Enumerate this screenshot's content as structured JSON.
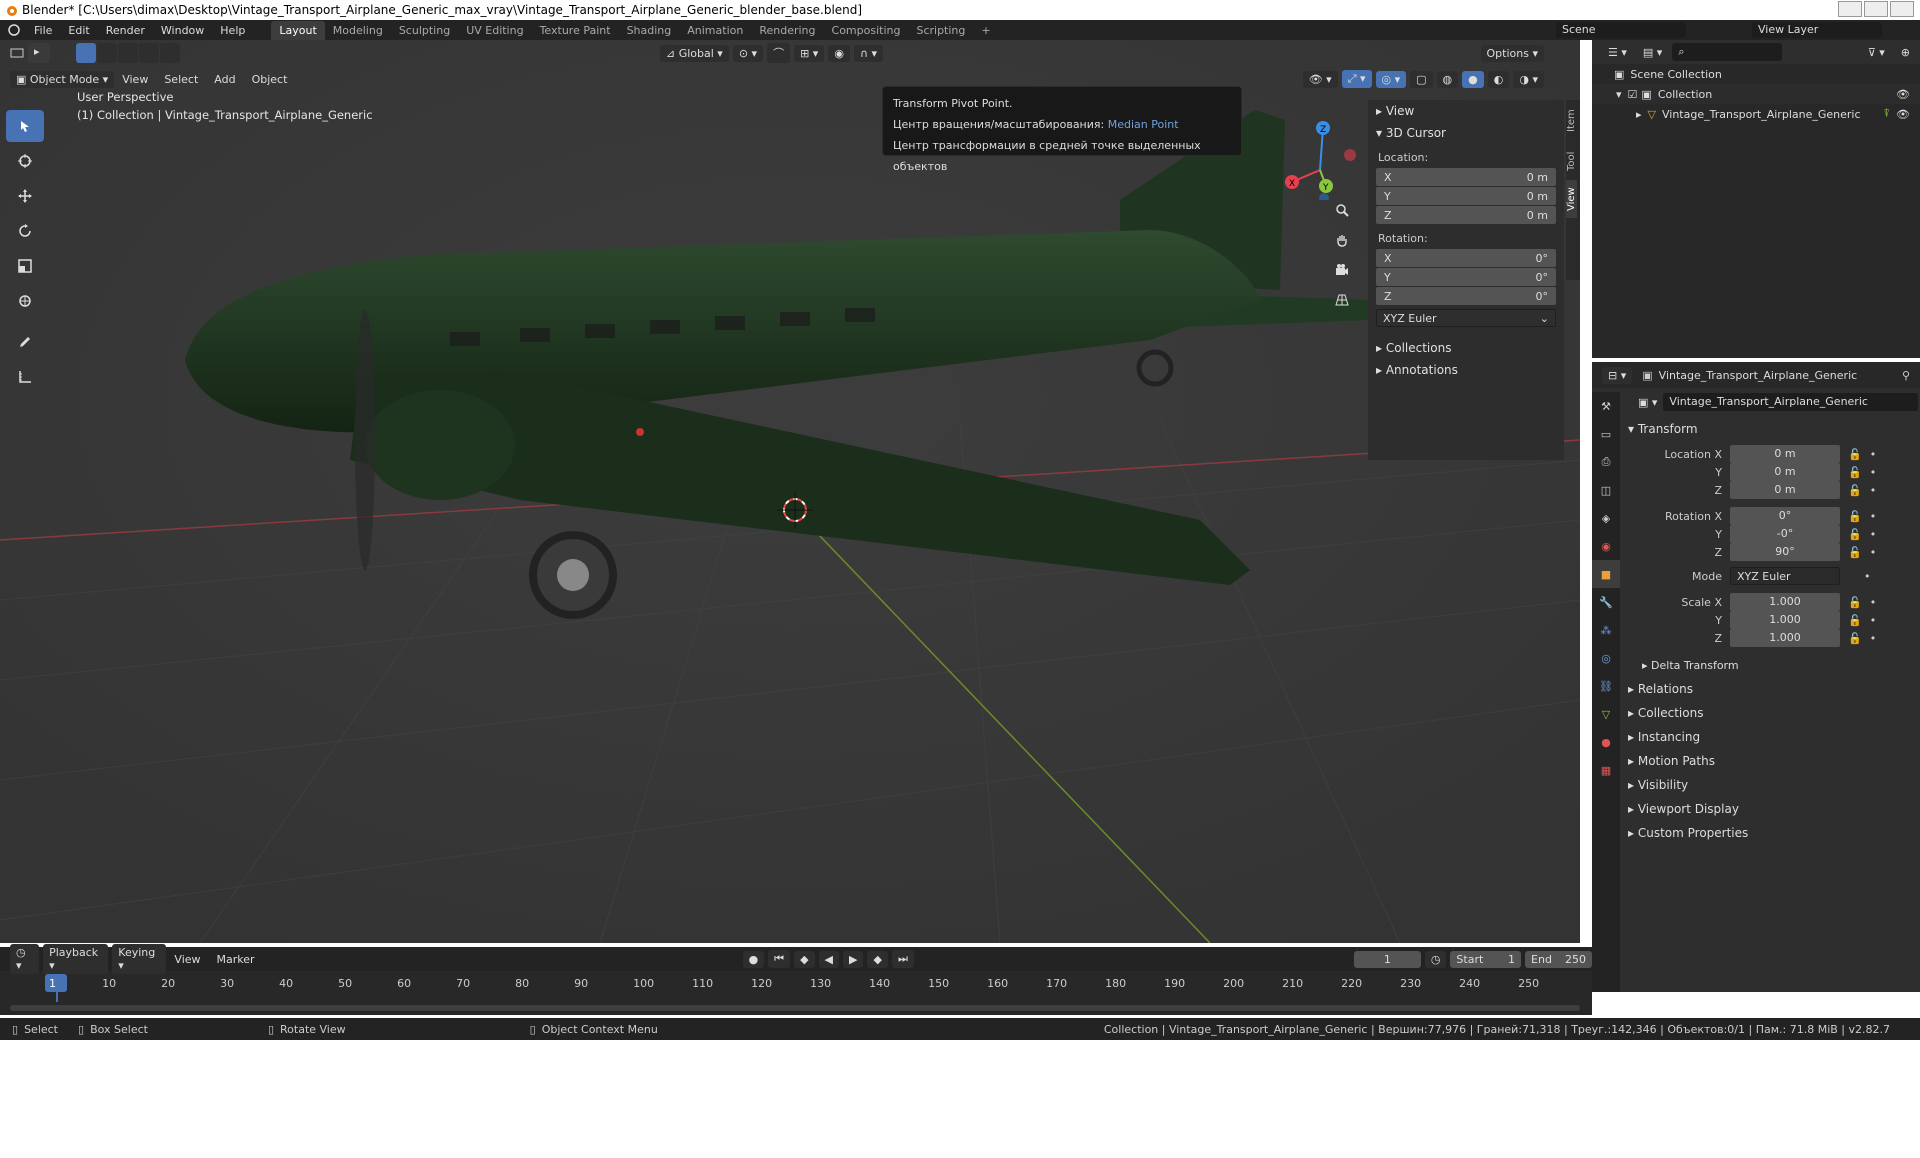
{
  "title_bar": {
    "text": "Blender* [C:\\Users\\dimax\\Desktop\\Vintage_Transport_Airplane_Generic_max_vray\\Vintage_Transport_Airplane_Generic_blender_base.blend]"
  },
  "menu": [
    "File",
    "Edit",
    "Render",
    "Window",
    "Help"
  ],
  "workspaces": [
    "Layout",
    "Modeling",
    "Sculpting",
    "UV Editing",
    "Texture Paint",
    "Shading",
    "Animation",
    "Rendering",
    "Compositing",
    "Scripting"
  ],
  "active_workspace": "Layout",
  "scene": "Scene",
  "view_layer": "View Layer",
  "viewport_header": {
    "mode": "Object Mode",
    "menus": [
      "View",
      "Select",
      "Add",
      "Object"
    ],
    "orientation": "Global",
    "options": "Options"
  },
  "viewport": {
    "perspective": "User Perspective",
    "collection_info": "(1) Collection | Vintage_Transport_Airplane_Generic"
  },
  "tooltip": {
    "title": "Transform Pivot Point.",
    "line2_label": "Центр вращения/масштабирования:",
    "line2_value": "Median Point",
    "line3": "Центр трансформации в средней точке выделенных объектов"
  },
  "gizmo": {
    "x": "X",
    "y": "Y",
    "z": "Z"
  },
  "npanel": {
    "view": "View",
    "cursor": "3D Cursor",
    "location_label": "Location:",
    "location": [
      {
        "axis": "X",
        "value": "0 m"
      },
      {
        "axis": "Y",
        "value": "0 m"
      },
      {
        "axis": "Z",
        "value": "0 m"
      }
    ],
    "rotation_label": "Rotation:",
    "rotation": [
      {
        "axis": "X",
        "value": "0°"
      },
      {
        "axis": "Y",
        "value": "0°"
      },
      {
        "axis": "Z",
        "value": "0°"
      }
    ],
    "rot_mode": "XYZ Euler",
    "collections": "Collections",
    "annotations": "Annotations",
    "tabs": [
      "Item",
      "Tool",
      "View"
    ]
  },
  "outliner": {
    "scene_collection": "Scene Collection",
    "collection": "Collection",
    "object": "Vintage_Transport_Airplane_Generic"
  },
  "properties": {
    "object_name": "Vintage_Transport_Airplane_Generic",
    "object_field": "Vintage_Transport_Airplane_Generic",
    "transform": "Transform",
    "loc_x_label": "Location X",
    "loc_x": "0 m",
    "loc_y_label": "Y",
    "loc_y": "0 m",
    "loc_z_label": "Z",
    "loc_z": "0 m",
    "rot_x_label": "Rotation X",
    "rot_x": "0°",
    "rot_y_label": "Y",
    "rot_y": "-0°",
    "rot_z_label": "Z",
    "rot_z": "90°",
    "mode_label": "Mode",
    "mode": "XYZ Euler",
    "scale_x_label": "Scale X",
    "scale_x": "1.000",
    "scale_y_label": "Y",
    "scale_y": "1.000",
    "scale_z_label": "Z",
    "scale_z": "1.000",
    "delta": "Delta Transform",
    "sections": [
      "Relations",
      "Collections",
      "Instancing",
      "Motion Paths",
      "Visibility",
      "Viewport Display",
      "Custom Properties"
    ]
  },
  "timeline": {
    "menus": [
      "Playback",
      "Keying",
      "View",
      "Marker"
    ],
    "current_frame": "1",
    "start_label": "Start",
    "start": "1",
    "end_label": "End",
    "end": "250",
    "ticks": [
      "1",
      "10",
      "20",
      "30",
      "40",
      "50",
      "60",
      "70",
      "80",
      "90",
      "100",
      "110",
      "120",
      "130",
      "140",
      "150",
      "160",
      "170",
      "180",
      "190",
      "200",
      "210",
      "220",
      "230",
      "240",
      "250"
    ]
  },
  "statusbar": {
    "select": "Select",
    "box_select": "Box Select",
    "rotate_view": "Rotate View",
    "context_menu": "Object Context Menu",
    "stats": "Collection | Vintage_Transport_Airplane_Generic | Вершин:77,976 | Граней:71,318 | Треуг.:142,346 | Объектов:0/1 | Пам.: 71.8 MiB | v2.82.7"
  },
  "colors": {
    "accent": "#4772b3",
    "x_axis": "#e8414e",
    "y_axis": "#8cc63f",
    "z_axis": "#3a8ee6",
    "airplane": "#1f3521"
  }
}
